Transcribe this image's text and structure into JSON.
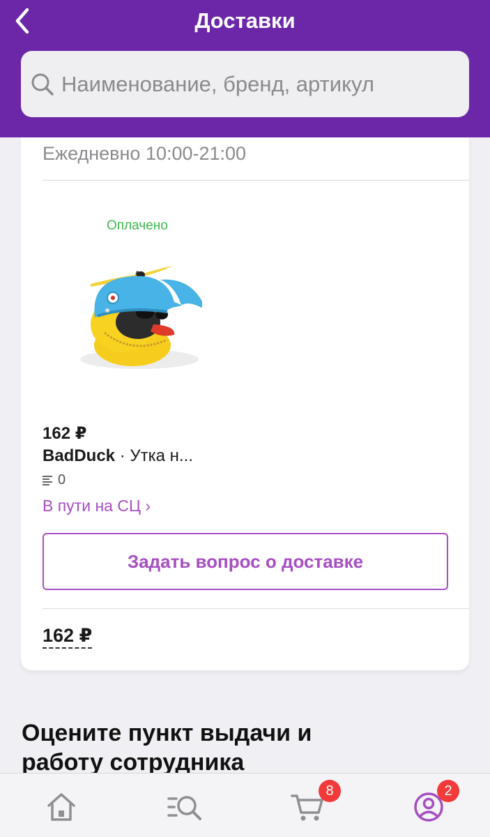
{
  "header": {
    "title": "Доставки"
  },
  "search": {
    "placeholder": "Наименование, бренд, артикул"
  },
  "pickup": {
    "hours": "Ежедневно 10:00-21:00"
  },
  "item": {
    "status": "Оплачено",
    "price": "162 ₽",
    "brand": "BadDuck",
    "separator": " · ",
    "name": "Утка н...",
    "reviews_count": "0",
    "delivery_status": "В пути на СЦ ›",
    "image_icon": "rubber-duck-with-helmet-image"
  },
  "actions": {
    "ask_label": "Задать вопрос о доставке"
  },
  "order": {
    "total": "162 ₽"
  },
  "rating": {
    "heading": "Оцените пункт выдачи и работу сотрудника"
  },
  "tabbar": {
    "cart_badge": "8",
    "profile_badge": "2"
  },
  "colors": {
    "header": "#6b27a8",
    "accent": "#a64ec2",
    "paid": "#3cb84f",
    "badge": "#f23a3a"
  }
}
